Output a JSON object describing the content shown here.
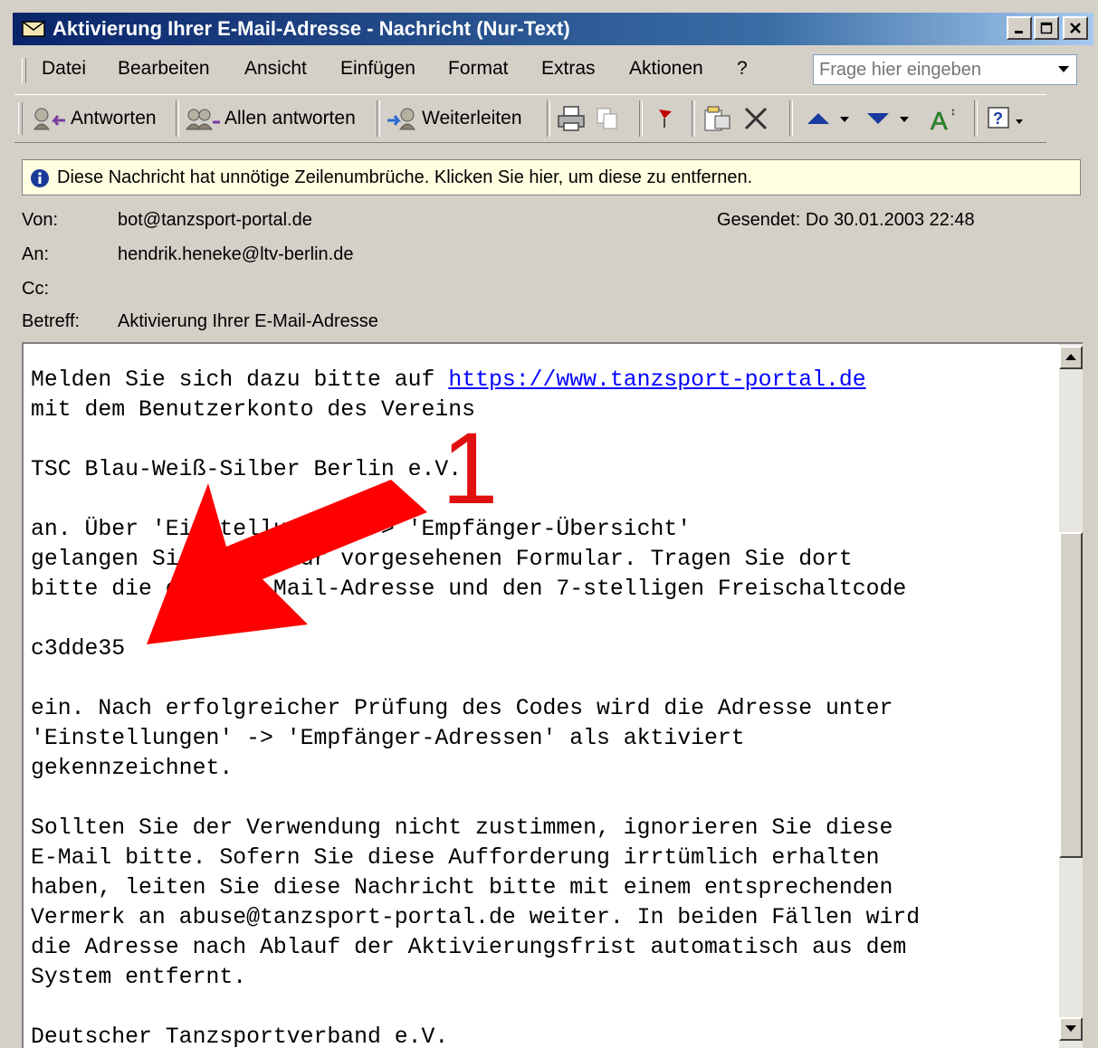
{
  "window": {
    "title": "Aktivierung Ihrer E-Mail-Adresse - Nachricht (Nur-Text)"
  },
  "menu": {
    "items": [
      {
        "label": "Datei"
      },
      {
        "label": "Bearbeiten"
      },
      {
        "label": "Ansicht"
      },
      {
        "label": "Einfügen"
      },
      {
        "label": "Format"
      },
      {
        "label": "Extras"
      },
      {
        "label": "Aktionen"
      },
      {
        "label": "?"
      }
    ],
    "ask_placeholder": "Frage hier eingeben"
  },
  "toolbar": {
    "reply": "Antworten",
    "reply_all": "Allen antworten",
    "forward": "Weiterleiten"
  },
  "infobar": {
    "text": "Diese Nachricht hat unnötige Zeilenumbrüche. Klicken Sie hier, um diese zu entfernen."
  },
  "header": {
    "from_label": "Von:",
    "from": "bot@tanzsport-portal.de",
    "sent": "Gesendet: Do 30.01.2003 22:48",
    "to_label": "An:",
    "to": "hendrik.heneke@ltv-berlin.de",
    "cc_label": "Cc:",
    "subject_label": "Betreff:",
    "subject": "Aktivierung Ihrer E-Mail-Adresse"
  },
  "body": {
    "line1_prefix": "Melden Sie sich dazu bitte auf ",
    "link": "https://www.tanzsport-portal.de",
    "lines": [
      "mit dem Benutzerkonto des Vereins",
      "",
      "TSC Blau-Weiß-Silber Berlin e.V.",
      "",
      "an. Über 'Einstellungen' -> 'Empfänger-Übersicht'",
      "gelangen Sie zum dafür vorgesehenen Formular. Tragen Sie dort",
      "bitte die obige E-Mail-Adresse und den 7-stelligen Freischaltcode",
      "",
      "c3dde35",
      "",
      "ein. Nach erfolgreicher Prüfung des Codes wird die Adresse unter",
      "'Einstellungen' -> 'Empfänger-Adressen' als aktiviert",
      "gekennzeichnet.",
      "",
      "Sollten Sie der Verwendung nicht zustimmen, ignorieren Sie diese",
      "E-Mail bitte. Sofern Sie diese Aufforderung irrtümlich erhalten",
      "haben, leiten Sie diese Nachricht bitte mit einem entsprechenden",
      "Vermerk an abuse@tanzsport-portal.de weiter. In beiden Fällen wird",
      "die Adresse nach Ablauf der Aktivierungsfrist automatisch aus dem",
      "System entfernt.",
      "",
      "Deutscher Tanzsportverband e.V."
    ]
  },
  "annotation": {
    "number": "1",
    "color": "#ff0000"
  }
}
